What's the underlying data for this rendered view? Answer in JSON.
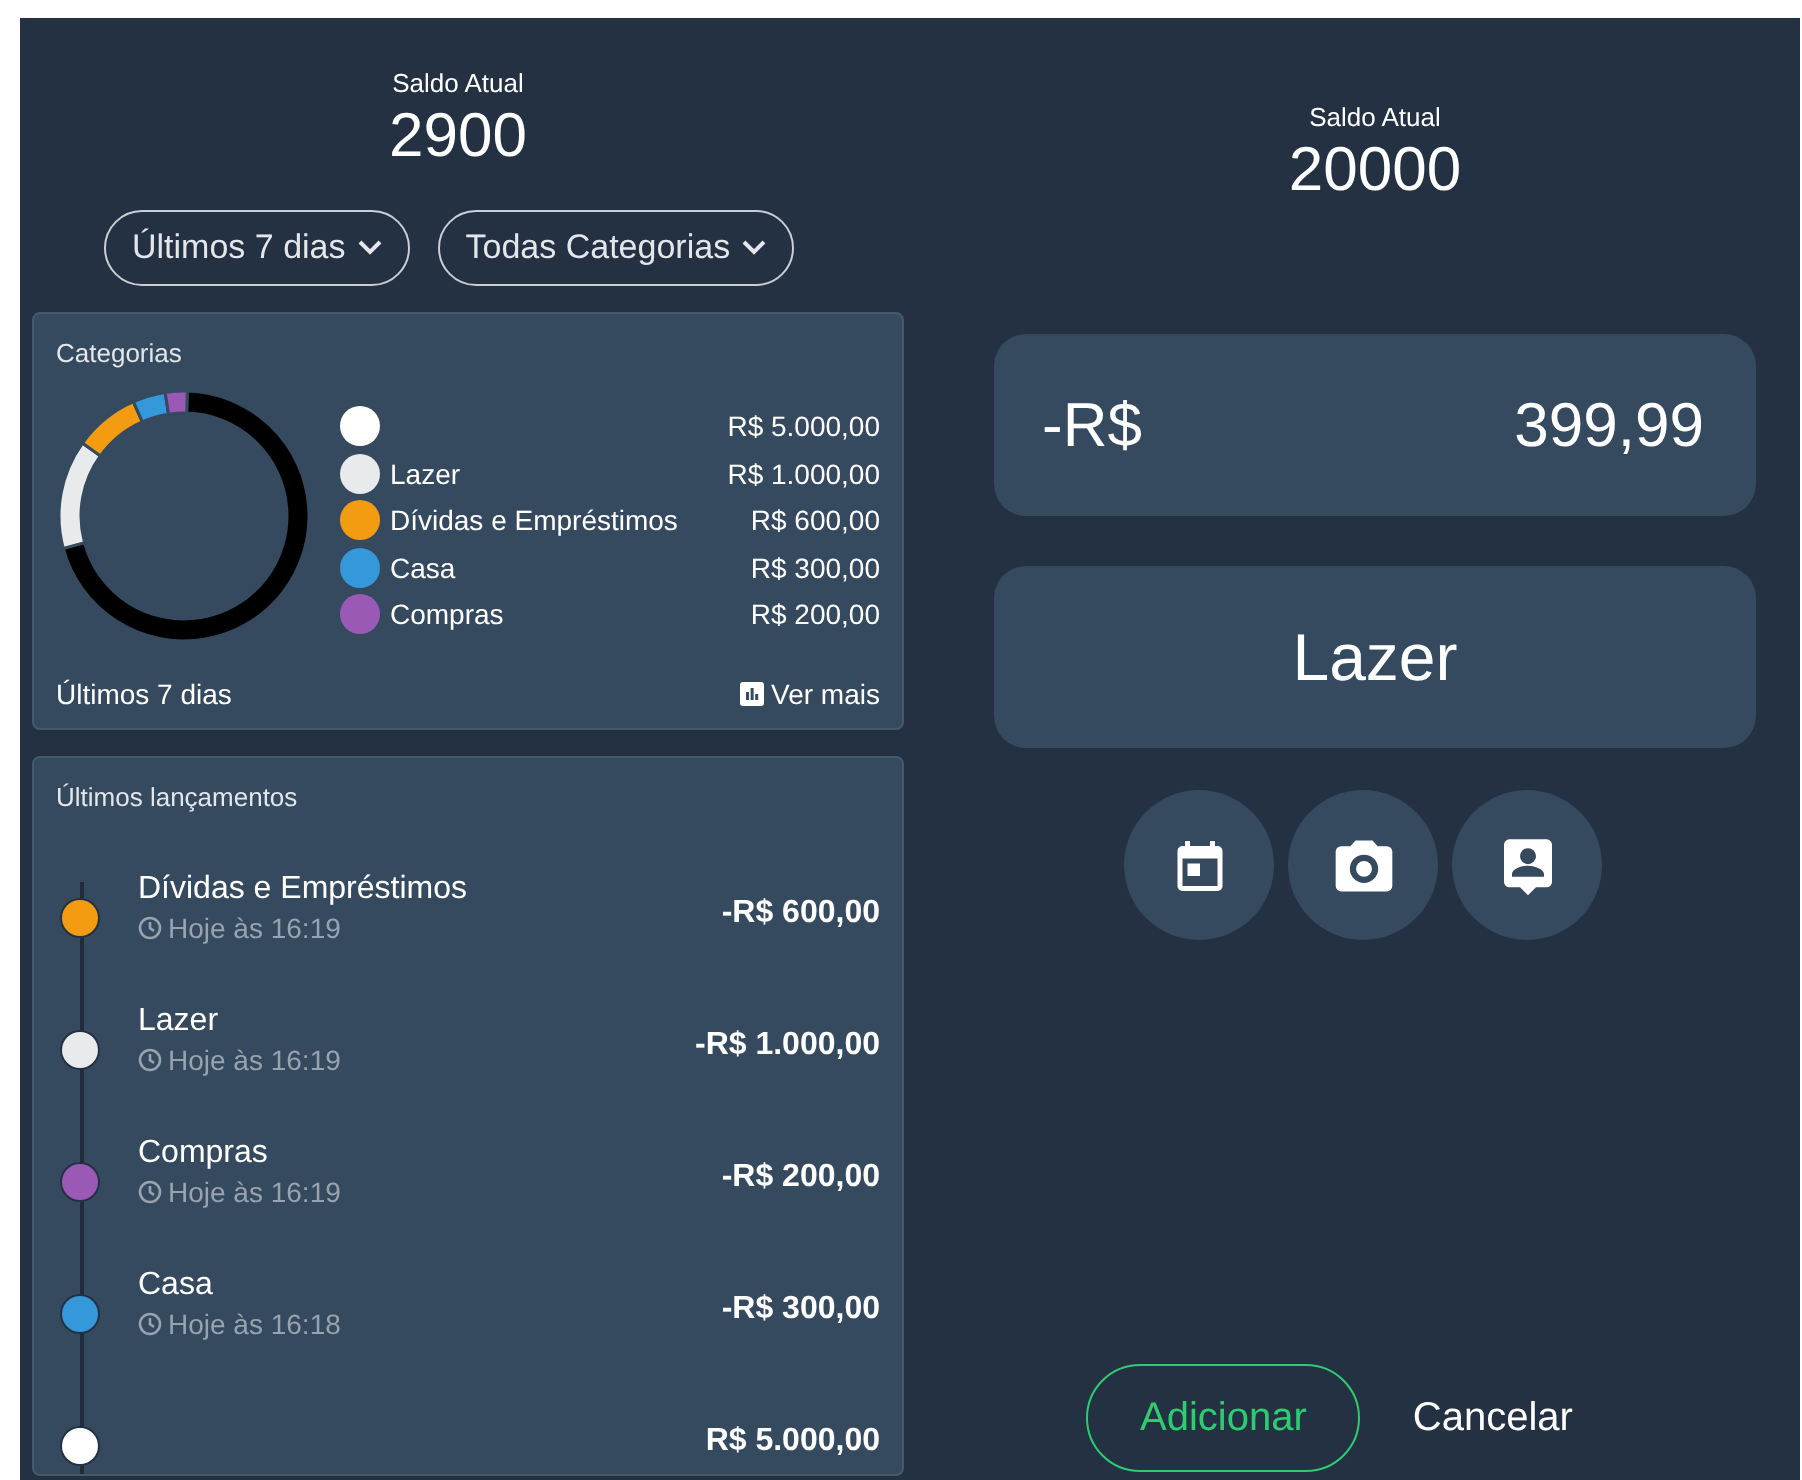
{
  "left_balance": {
    "label": "Saldo Atual",
    "value": "2900"
  },
  "filters": [
    {
      "label": "Últimos 7 dias"
    },
    {
      "label": "Todas Categorias"
    }
  ],
  "categories_card": {
    "title": "Categorias",
    "legend": [
      {
        "amount": "R$ 5.000,00",
        "color": "#ffffff"
      },
      {
        "name": "Lazer",
        "amount": "R$ 1.000,00",
        "color": "#e8eaec"
      },
      {
        "name": "Dívidas e Empréstimos",
        "amount": "R$ 600,00",
        "color": "#f39c12"
      },
      {
        "name": "Casa",
        "amount": "R$ 300,00",
        "color": "#3498db"
      },
      {
        "name": "Compras",
        "amount": "R$ 200,00",
        "color": "#9b59b6"
      }
    ],
    "chart_data": {
      "type": "donut",
      "values": [
        70.42,
        14.08,
        8.45,
        4.23,
        2.82
      ],
      "colors": [
        "#000000",
        "#e8eaec",
        "#f39c12",
        "#3498db",
        "#9b59b6"
      ]
    },
    "period": "Últimos 7 dias",
    "more_link": "Ver mais"
  },
  "entries_card": {
    "title": "Últimos lançamentos",
    "entries": [
      {
        "name": "Dívidas e Empréstimos",
        "time": "Hoje às 16:19",
        "amount": "-R$ 600,00",
        "color": "#f39c12"
      },
      {
        "name": "Lazer",
        "time": "Hoje às 16:19",
        "amount": "-R$ 1.000,00",
        "color": "#e8eaec"
      },
      {
        "name": "Compras",
        "time": "Hoje às 16:19",
        "amount": "-R$ 200,00",
        "color": "#9b59b6"
      },
      {
        "name": "Casa",
        "time": "Hoje às 16:18",
        "amount": "-R$ 300,00",
        "color": "#3498db"
      },
      {
        "amount": "R$ 5.000,00",
        "color": "#ffffff"
      }
    ]
  },
  "right_balance": {
    "label": "Saldo Atual",
    "value": "20000"
  },
  "amount_field": {
    "prefix": "-R$",
    "value": "399,99"
  },
  "category_field": {
    "value": "Lazer"
  },
  "attachments": [
    {
      "kind": "calendar"
    },
    {
      "kind": "camera"
    },
    {
      "kind": "contact"
    }
  ],
  "buttons": [
    {
      "label": "Adicionar",
      "kind": "primary"
    },
    {
      "label": "Cancelar",
      "kind": "text"
    }
  ]
}
